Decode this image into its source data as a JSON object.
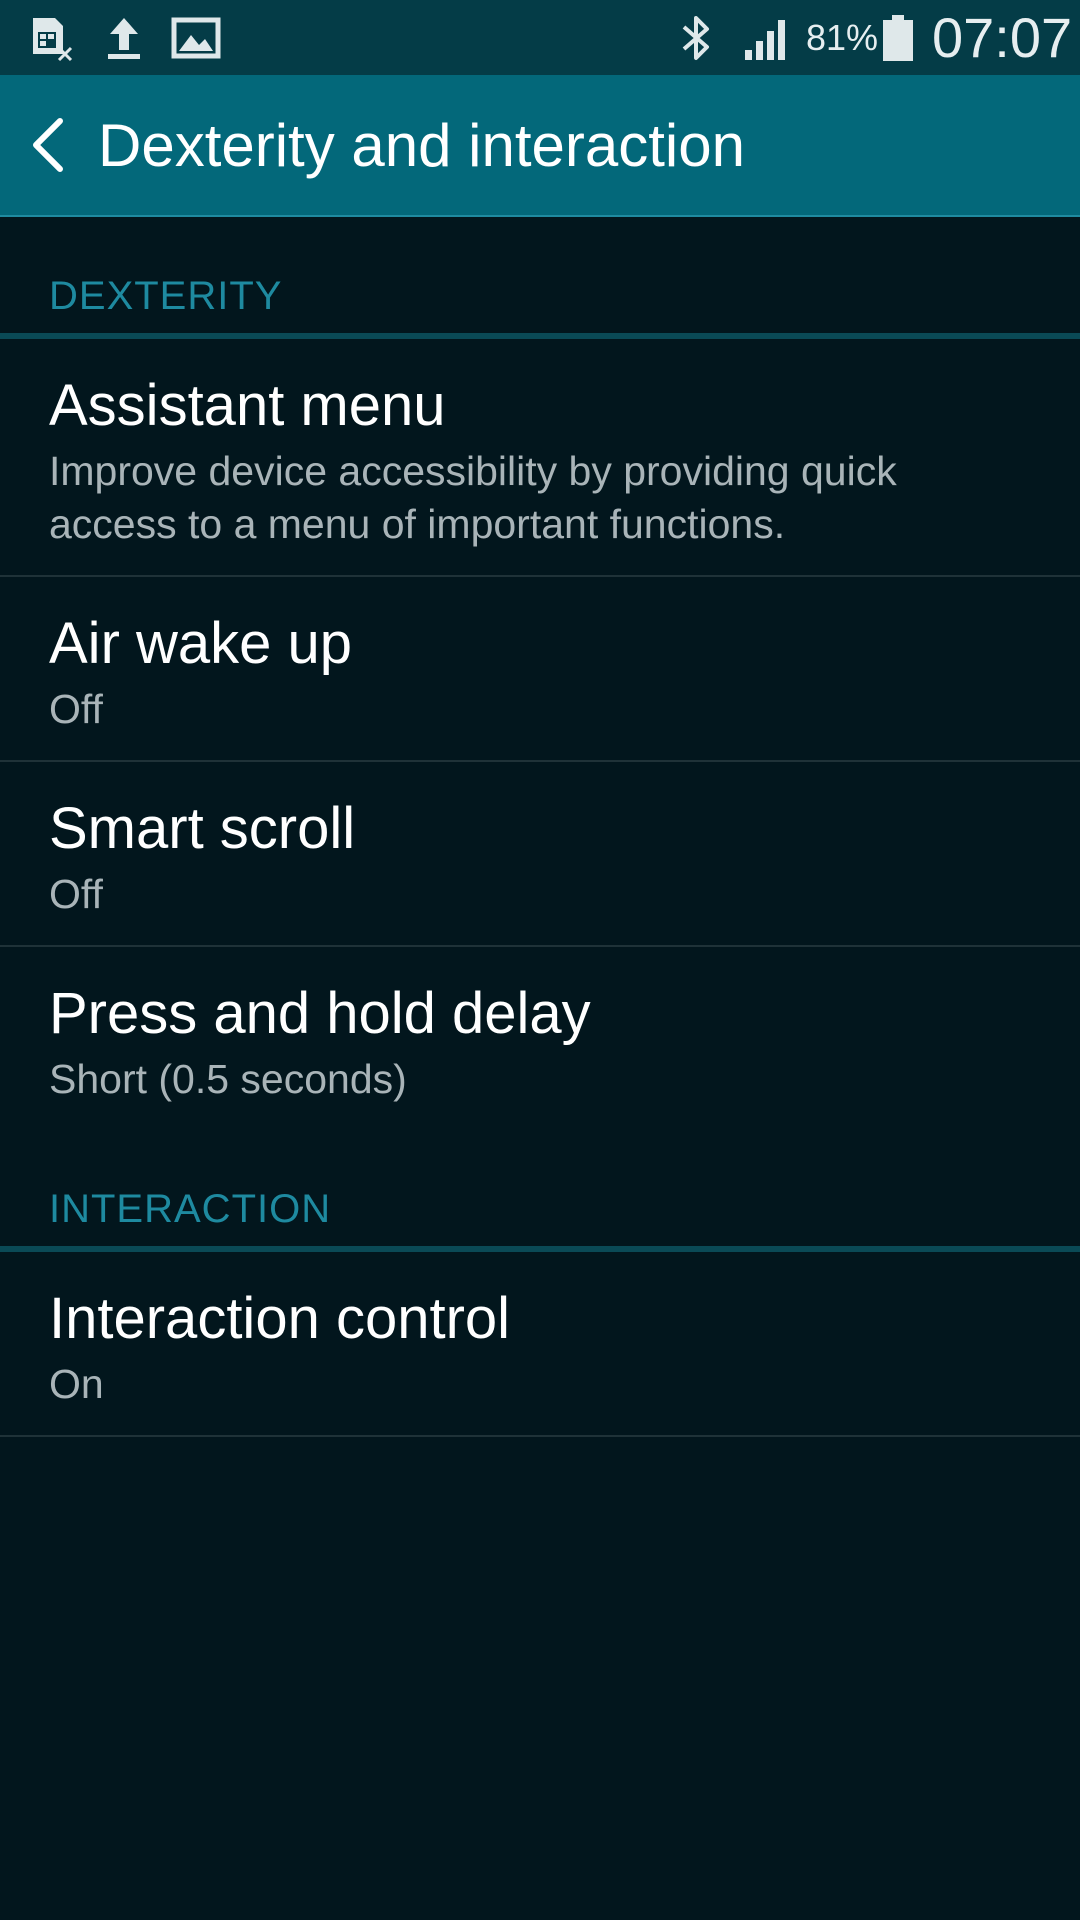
{
  "status_bar": {
    "icons": [
      "sim-card-x-icon",
      "upload-icon",
      "image-icon",
      "bluetooth-icon",
      "signal-icon",
      "battery-icon"
    ],
    "battery_percent": "81%",
    "time": "07:07"
  },
  "action_bar": {
    "title": "Dexterity and interaction"
  },
  "sections": [
    {
      "header": "DEXTERITY",
      "items": [
        {
          "title": "Assistant menu",
          "subtitle": "Improve device accessibility by providing quick access to a menu of important functions."
        },
        {
          "title": "Air wake up",
          "subtitle": "Off"
        },
        {
          "title": "Smart scroll",
          "subtitle": "Off"
        },
        {
          "title": "Press and hold delay",
          "subtitle": "Short (0.5 seconds)"
        }
      ]
    },
    {
      "header": "INTERACTION",
      "items": [
        {
          "title": "Interaction control",
          "subtitle": "On"
        }
      ]
    }
  ],
  "colors": {
    "status_bar_bg": "#043c47",
    "action_bar_bg": "#03687a",
    "page_bg": "#02161d",
    "section_header_text": "#1e8aa0"
  }
}
